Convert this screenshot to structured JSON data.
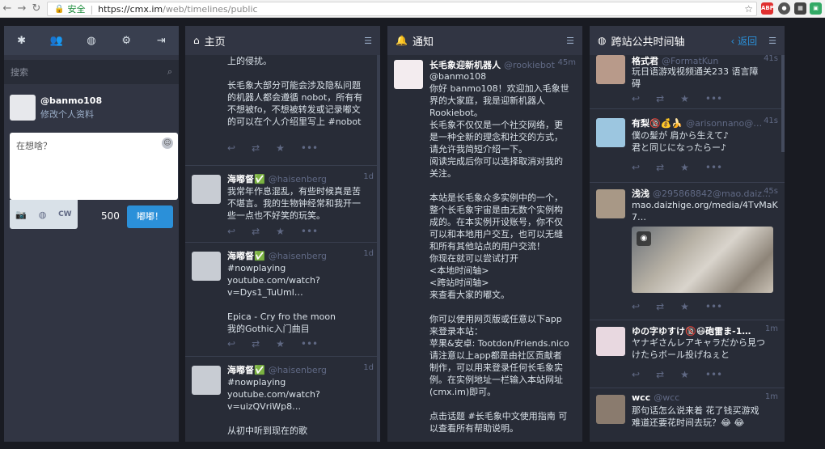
{
  "browser": {
    "secure_label": "安全",
    "url_host": "https://cmx.im",
    "url_path": "/web/timelines/public"
  },
  "drawer": {
    "search_placeholder": "搜索",
    "handle": "@banmo108",
    "edit_profile": "修改个人资料",
    "compose_placeholder": "在想啥？",
    "cw_label": "CW",
    "char_count": "500",
    "toot_button": "嘟嘟！"
  },
  "home": {
    "title": "主页",
    "top_text": "上的侵扰。\n\n长毛象大部分可能会涉及隐私问题\n的机器人都会遵循 nobot，所有有\n不想被fo，不想被转发或记录嘟文\n的可以在个人介绍里写上 #nobot",
    "statuses": [
      {
        "name": "海嘟督✅",
        "acct": "@haisenberg",
        "time": "1d",
        "text": "我常年作息混乱，有些时候真是苦\n不堪言。我的生物钟经常和我开一\n些一点也不好笑的玩笑。"
      },
      {
        "name": "海嘟督✅",
        "acct": "@haisenberg",
        "time": "1d",
        "text": "#nowplaying\nyoutube.com/watch?\nv=Dys1_TuUml…\n\nEpica - Cry fro the moon\n我的Gothic入门曲目"
      },
      {
        "name": "海嘟督✅",
        "acct": "@haisenberg",
        "time": "1d",
        "text": "#nowplaying\nyoutube.com/watch?\nv=uizQVriWp8…\n\n从初中听到现在的歌"
      }
    ]
  },
  "notifications": {
    "title": "通知",
    "name": "长毛象迎新机器人",
    "acct": "@rookiebot",
    "time": "45m",
    "mention": "@banmo108",
    "text": "你好 banmo108！欢迎加入毛象世\n界的大家庭，我是迎新机器人\nRookiebot。\n长毛象不仅仅是一个社交网络，更\n是一种全新的理念和社交的方式，\n请允许我简短介绍一下。\n阅读完成后你可以选择取消对我的\n关注。\n\n本站是长毛象众多实例中的一个，\n整个长毛象宇宙是由无数个实例构\n成的。在本实例开设账号，你不仅\n可以和本地用户交互，也可以无缝\n和所有其他站点的用户交流！\n你现在就可以尝试打开\n<本地时间轴>\n<跨站时间轴>\n来查看大家的嘟文。\n\n你可以使用网页版或任意以下app\n来登录本站：\n苹果&安卓: Tootdon/Friends.nico\n请注意以上app都是由社区贡献者\n制作，可以用来登录任何长毛象实\n例。在实例地址一栏输入本站网址\n(cmx.im)即可。\n\n点击话题 #长毛象中文使用指南 可\n以查看所有帮助说明。"
  },
  "federated": {
    "title": "跨站公共时间轴",
    "back": "返回",
    "statuses": [
      {
        "name": "格式君",
        "acct": "@FormatKun",
        "time": "41s",
        "text": "玩日语游戏视频通关233 语言障\n碍"
      },
      {
        "name": "有梨🔞💰🍌",
        "acct": "@arisonnano@…",
        "time": "41s",
        "text": "僕の髪が 肩から生えて♪\n君と同じになったらー♪"
      },
      {
        "name": "浅浅",
        "acct": "@295868842@mao.daiz…",
        "time": "45s",
        "text": "mao.daizhige.org/media/4TvMaK\n7…"
      },
      {
        "name": "ゆの字ゆすけ🔞😷砲雷ま-1…",
        "acct": "",
        "time": "1m",
        "text": "ヤナギさんレアキャラだから見つ\nけたらボール投げねぇと"
      },
      {
        "name": "wcc",
        "acct": "@wcc",
        "time": "1m",
        "text": "那句话怎么说来着 花了钱买游戏\n难道还要花时间去玩？😂 😂"
      }
    ]
  },
  "colors": {
    "accent": "#2b90d9",
    "column_bg": "#282c37",
    "header_bg": "#313543",
    "page_bg": "#191b22"
  }
}
